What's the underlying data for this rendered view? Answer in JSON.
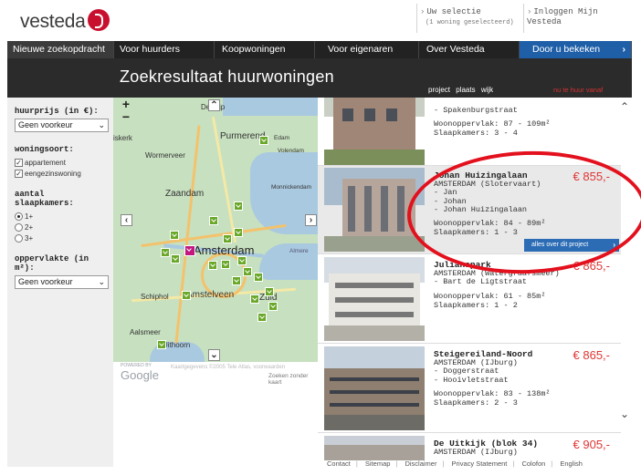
{
  "header": {
    "logo": "vesteda",
    "selection_label": "Uw selectie",
    "selection_sub": "(1 woning geselecteerd)",
    "login_label": "Inloggen Mijn Vesteda"
  },
  "nav": {
    "items": [
      {
        "label": "Nieuwe zoekopdracht"
      },
      {
        "label": "Voor huurders"
      },
      {
        "label": "Koopwoningen"
      },
      {
        "label": "Voor eigenaren"
      },
      {
        "label": "Over Vesteda"
      },
      {
        "label": "Door u bekeken"
      }
    ]
  },
  "title": "Zoekresultaat huurwoningen",
  "sort": {
    "items": [
      "project",
      "plaats",
      "wijk"
    ],
    "price_label": "nu te huur vanaf"
  },
  "filters": {
    "price_label": "huurprijs (in €):",
    "price_value": "Geen voorkeur",
    "type_label": "woningsoort:",
    "type_options": [
      {
        "label": "appartement",
        "checked": true
      },
      {
        "label": "eengezinswoning",
        "checked": true
      }
    ],
    "rooms_label": "aantal slaapkamers:",
    "rooms_options": [
      {
        "label": "1+",
        "selected": true
      },
      {
        "label": "2+",
        "selected": false
      },
      {
        "label": "3+",
        "selected": false
      }
    ],
    "area_label": "oppervlakte (in m²):",
    "area_value": "Geen voorkeur"
  },
  "map": {
    "labels": {
      "derijp": "De Rijp",
      "purmerend": "Purmerend",
      "edam": "Edam",
      "volendam": "Volendam",
      "wormerveer": "Wormerveer",
      "monnickendam": "Monnickendam",
      "zaandam": "Zaandam",
      "amsterdam": "Amsterdam",
      "amstelveen": "Amstelveen",
      "schiphol": "Schiphol",
      "zuid": "Zuid",
      "aalsmeer": "Aalsmeer",
      "uithoorn": "Uithoorn",
      "almere": "Almere",
      "beverwijk": "iskerk"
    },
    "google": "Google",
    "powered": "POWERED BY",
    "credit": "Kaartgegevens ©2005 Tele Atlas, voorwaarden",
    "no_map": "Zoeken zonder kaart"
  },
  "results": [
    {
      "name": "",
      "city": "",
      "streets": [
        "- Spakenburgstraat"
      ],
      "area": "Woonoppervlak: 87 - 109m²",
      "rooms": "Slaapkamers: 3 - 4",
      "price": ""
    },
    {
      "name": "Johan Huizingalaan",
      "city": "AMSTERDAM (Slotervaart)",
      "streets": [
        "- Jan",
        "- Johan",
        "- Johan Huizingalaan"
      ],
      "area": "Woonoppervlak: 84 - 89m²",
      "rooms": "Slaapkamers: 1 - 3",
      "price": "€ 855,-",
      "button": "alles over dit project"
    },
    {
      "name": "Julianapark",
      "city": "AMSTERDAM (Watergraafsmeer)",
      "streets": [
        "- Bart de Ligtstraat"
      ],
      "area": "Woonoppervlak: 61 - 85m²",
      "rooms": "Slaapkamers: 1 - 2",
      "price": "€ 865,-"
    },
    {
      "name": "Steigereiland-Noord",
      "city": "AMSTERDAM (IJburg)",
      "streets": [
        "- Doggerstraat",
        "- Hooivletstraat"
      ],
      "area": "Woonoppervlak: 83 - 138m²",
      "rooms": "Slaapkamers: 2 - 3",
      "price": "€ 865,-"
    },
    {
      "name": "De Uitkijk (blok 34)",
      "city": "AMSTERDAM (IJburg)",
      "streets": [],
      "area": "",
      "rooms": "",
      "price": "€ 905,-"
    }
  ],
  "footer": {
    "links": [
      "Contact",
      "Sitemap",
      "Disclaimer",
      "Privacy Statement",
      "Colofon",
      "English"
    ]
  },
  "colors": {
    "nav_bg": "#222222",
    "accent_blue": "#1f5fa8",
    "price_red": "#e03434",
    "annotation_red": "#e3101d",
    "marker_green": "#6aa82a",
    "marker_pink": "#c2187f"
  }
}
